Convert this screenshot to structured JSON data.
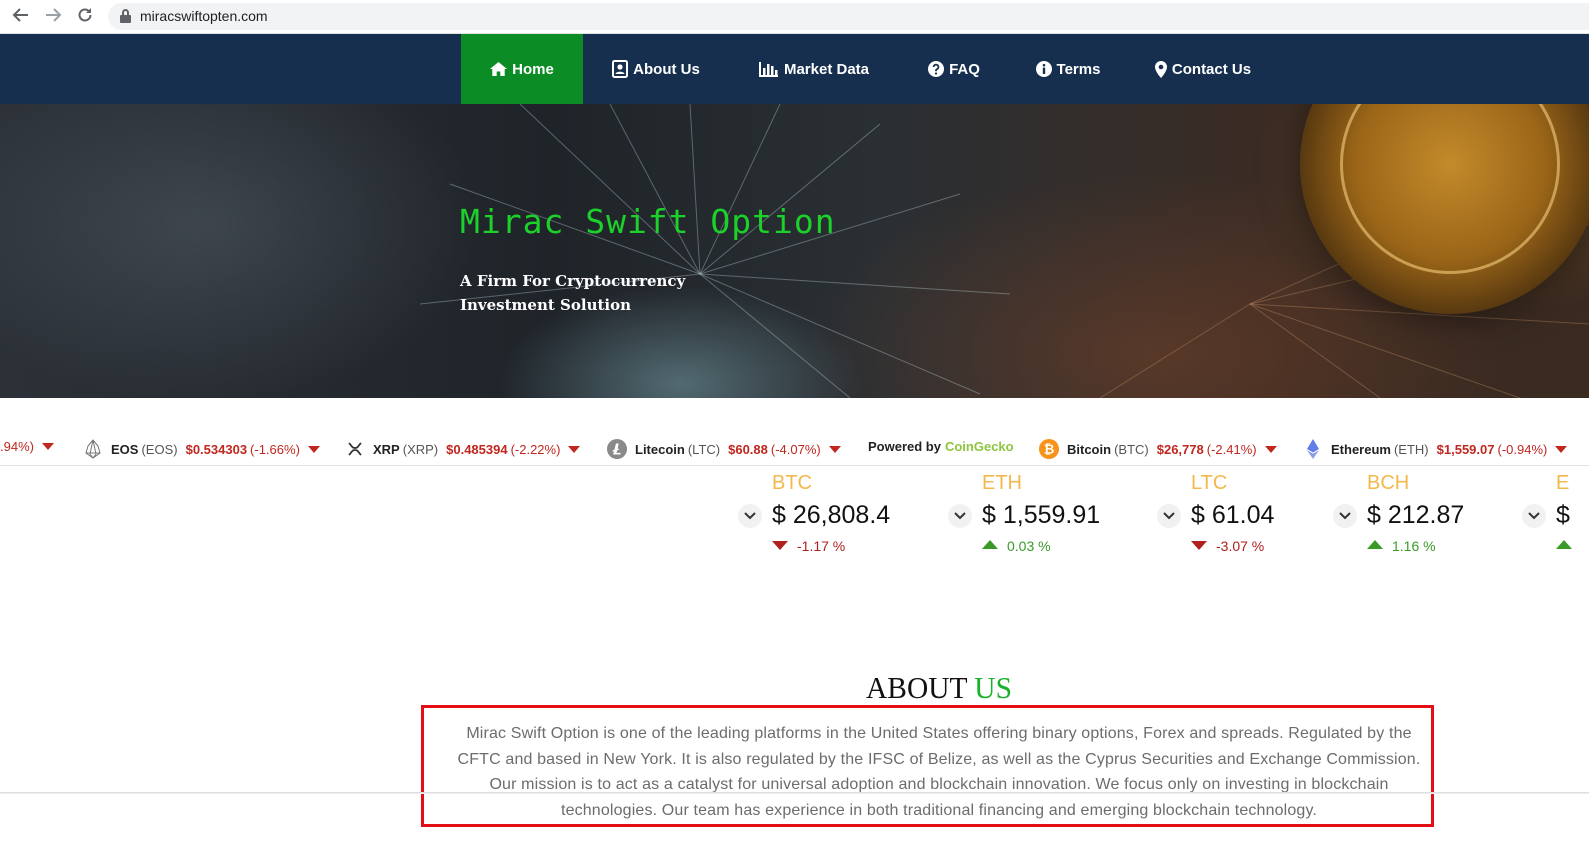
{
  "browser": {
    "url": "miracswiftopten.com",
    "icons": [
      "back-icon",
      "forward-icon",
      "reload-icon",
      "lock-icon"
    ]
  },
  "nav": {
    "items": [
      {
        "label": "Home",
        "icon": "home-icon",
        "active": true
      },
      {
        "label": "About Us",
        "icon": "address-card-icon",
        "active": false
      },
      {
        "label": "Market Data",
        "icon": "bar-chart-icon",
        "active": false
      },
      {
        "label": "FAQ",
        "icon": "question-circle-icon",
        "active": false
      },
      {
        "label": "Terms",
        "icon": "info-circle-icon",
        "active": false
      },
      {
        "label": "Contact Us",
        "icon": "map-marker-icon",
        "active": false
      }
    ],
    "colors": {
      "bar": "#172f4f",
      "active": "#0c8c24"
    }
  },
  "hero": {
    "title": "Mirac Swift Option",
    "subtitle_line1": "A Firm For Cryptocurrency",
    "subtitle_line2": "Investment Solution",
    "title_color": "#1bd12a"
  },
  "ticker": {
    "partial_change": ".94%)",
    "items": [
      {
        "name": "EOS",
        "symbol": "(EOS)",
        "price": "$0.534303",
        "change": "(-1.66%)"
      },
      {
        "name": "XRP",
        "symbol": "(XRP)",
        "price": "$0.485394",
        "change": "(-2.22%)"
      },
      {
        "name": "Litecoin",
        "symbol": "(LTC)",
        "price": "$60.88",
        "change": "(-4.07%)"
      },
      {
        "name": "Bitcoin",
        "symbol": "(BTC)",
        "price": "$26,778",
        "change": "(-2.41%)"
      },
      {
        "name": "Ethereum",
        "symbol": "(ETH)",
        "price": "$1,559.07",
        "change": "(-0.94%)"
      }
    ],
    "powered_by": "Powered by",
    "provider": "CoinGecko"
  },
  "prices": [
    {
      "symbol": "BTC",
      "price": "$ 26,808.4",
      "change": "-1.17 %",
      "direction": "down"
    },
    {
      "symbol": "ETH",
      "price": "$ 1,559.91",
      "change": "0.03 %",
      "direction": "up"
    },
    {
      "symbol": "LTC",
      "price": "$ 61.04",
      "change": "-3.07 %",
      "direction": "down"
    },
    {
      "symbol": "BCH",
      "price": "$ 212.87",
      "change": "1.16 %",
      "direction": "up"
    },
    {
      "symbol": "E",
      "price": "$",
      "change": "",
      "direction": "up"
    }
  ],
  "about": {
    "title_main": "ABOUT",
    "title_accent": "US",
    "text": "Mirac Swift Option is one of the leading platforms in the United States offering binary options, Forex and spreads. Regulated by the CFTC and based in New York. It is also regulated by the IFSC of Belize, as well as the Cyprus Securities and Exchange Commission. Our mission is to act as a catalyst for universal adoption and blockchain innovation. We focus only on investing in blockchain technologies. Our team has experience in both traditional financing and emerging blockchain technology."
  }
}
